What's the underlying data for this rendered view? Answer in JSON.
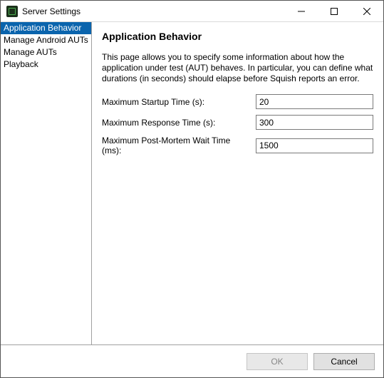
{
  "window": {
    "title": "Server Settings"
  },
  "sidebar": {
    "items": [
      {
        "label": "Application Behavior",
        "selected": true
      },
      {
        "label": "Manage Android AUTs",
        "selected": false
      },
      {
        "label": "Manage AUTs",
        "selected": false
      },
      {
        "label": "Playback",
        "selected": false
      }
    ]
  },
  "content": {
    "heading": "Application Behavior",
    "description": "This page allows you to specify some information about how the application under test (AUT) behaves. In particular, you can define what durations (in seconds) should elapse before Squish reports an error.",
    "fields": [
      {
        "label": "Maximum Startup Time (s):",
        "value": "20"
      },
      {
        "label": "Maximum Response Time (s):",
        "value": "300"
      },
      {
        "label": "Maximum Post-Mortem Wait Time (ms):",
        "value": "1500"
      }
    ]
  },
  "footer": {
    "ok": "OK",
    "cancel": "Cancel"
  }
}
